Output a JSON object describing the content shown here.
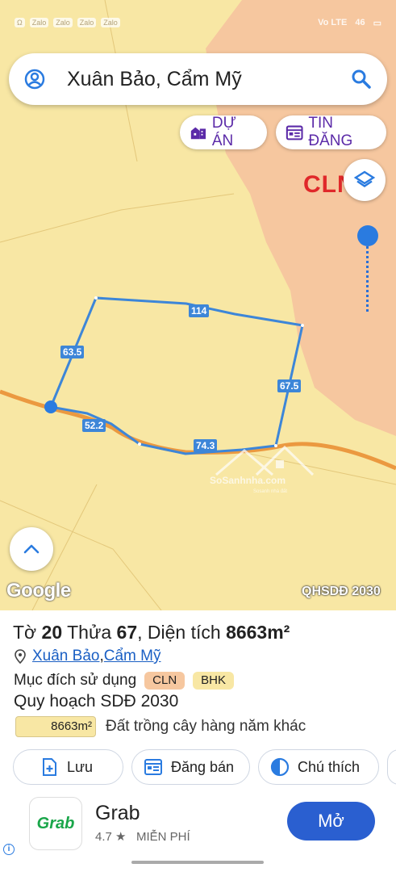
{
  "status_bar": {
    "left_icons": [
      "Ω",
      "Zalo",
      "Zalo",
      "Zalo",
      "Zalo",
      "•"
    ],
    "right_text": [
      "Vo LTE",
      "46",
      "▭"
    ]
  },
  "search": {
    "query": "Xuân Bảo, Cẩm Mỹ"
  },
  "chips": {
    "du_an": "DỰ ÁN",
    "tin_dang": "TIN ĐĂNG"
  },
  "map": {
    "zone_label": "CLN",
    "edge_labels": [
      "114",
      "63.5",
      "67.5",
      "52.2",
      "74.3"
    ],
    "google_logo": "Google",
    "layer_logo": "QHSDĐ 2030",
    "watermark_text": "SoSanhnha.com",
    "watermark_sub": "Sosanh nhà đất",
    "colors": {
      "base": "#f8e7a4",
      "cln_zone": "#f6c79f",
      "parcel_outline": "#3d86d8",
      "road": "#e98b2f"
    }
  },
  "parcel": {
    "title_prefix": "Tờ",
    "sheet": "20",
    "plot_prefix": "Thửa",
    "plot": "67",
    "area_prefix": ", Diện tích",
    "area": "8663m²",
    "address_1": "Xuân Bảo",
    "address_sep": ", ",
    "address_2": "Cẩm Mỹ",
    "purpose_label": "Mục đích sử dụng",
    "purpose_tags": [
      "CLN",
      "BHK"
    ],
    "plan_label": "Quy hoạch SDĐ 2030",
    "plan_area": "8663m²",
    "plan_desc": "Đất trồng cây hàng năm khác"
  },
  "actions": {
    "save": "Lưu",
    "post": "Đăng bán",
    "legend": "Chú thích"
  },
  "ad": {
    "logo_text": "Grab",
    "title": "Grab",
    "rating": "4.7 ★",
    "price": "MIỄN PHÍ",
    "button": "Mở"
  }
}
